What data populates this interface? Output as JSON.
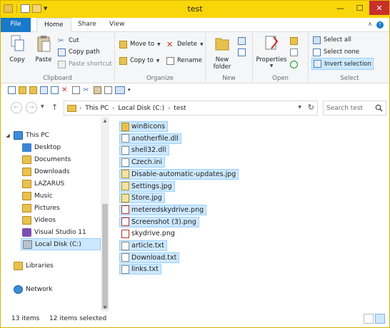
{
  "window": {
    "title": "test"
  },
  "title_controls": {
    "minimize": "—",
    "maximize": "☐",
    "close": "✕"
  },
  "tabs": {
    "file": "File",
    "home": "Home",
    "share": "Share",
    "view": "View"
  },
  "ribbon": {
    "clipboard": {
      "label": "Clipboard",
      "copy": "Copy",
      "paste": "Paste",
      "cut": "Cut",
      "copy_path": "Copy path",
      "paste_shortcut": "Paste shortcut"
    },
    "organize": {
      "label": "Organize",
      "move_to": "Move to",
      "copy_to": "Copy to",
      "delete": "Delete",
      "rename": "Rename"
    },
    "new": {
      "label": "New",
      "new_folder": "New folder"
    },
    "open": {
      "label": "Open",
      "properties": "Properties"
    },
    "select": {
      "label": "Select",
      "select_all": "Select all",
      "select_none": "Select none",
      "invert_selection": "Invert selection"
    }
  },
  "address": {
    "crumbs": [
      "This PC",
      "Local Disk (C:)",
      "test"
    ],
    "search_placeholder": "Search test"
  },
  "nav": {
    "this_pc": "This PC",
    "items": [
      "Desktop",
      "Documents",
      "Downloads",
      "LAZARUS",
      "Music",
      "Pictures",
      "Videos",
      "Visual Studio 11",
      "Local Disk (C:)"
    ],
    "libraries": "Libraries",
    "network": "Network"
  },
  "files": [
    {
      "name": "win8icons",
      "icon": "folder-icon",
      "selected": true
    },
    {
      "name": "anotherfile.dll",
      "icon": "dll-file-icon",
      "selected": true
    },
    {
      "name": "shell32.dll",
      "icon": "dll-file-icon",
      "selected": true
    },
    {
      "name": "Czech.ini",
      "icon": "ini-file-icon",
      "selected": true
    },
    {
      "name": "Disable-automatic-updates.jpg",
      "icon": "jpg-file-icon",
      "selected": true
    },
    {
      "name": "Settings.jpg",
      "icon": "jpg-file-icon",
      "selected": true
    },
    {
      "name": "Store.jpg",
      "icon": "jpg-file-icon",
      "selected": true
    },
    {
      "name": "meteredskydrive.png",
      "icon": "png-file-icon",
      "selected": true
    },
    {
      "name": "Screenshot (3).png",
      "icon": "png-file-icon",
      "selected": true
    },
    {
      "name": "skydrive.png",
      "icon": "png-file-icon",
      "selected": false
    },
    {
      "name": "article.txt",
      "icon": "txt-file-icon",
      "selected": true
    },
    {
      "name": "Download.txt",
      "icon": "txt-file-icon",
      "selected": true
    },
    {
      "name": "links.txt",
      "icon": "txt-file-icon",
      "selected": true
    }
  ],
  "status": {
    "count": "13 items",
    "selected": "12 items selected"
  },
  "colors": {
    "titlebar": "#f9d60a",
    "file_tab": "#1979ca",
    "selection": "#cce8ff",
    "selection_border": "#99d1ff",
    "close": "#c7302a"
  }
}
